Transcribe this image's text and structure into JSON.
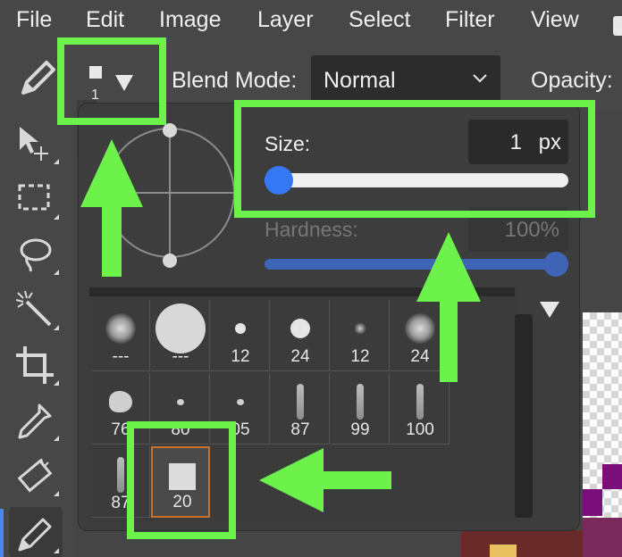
{
  "menu": {
    "items": [
      "File",
      "Edit",
      "Image",
      "Layer",
      "Select",
      "Filter",
      "View"
    ]
  },
  "options_bar": {
    "brush_preview_size": "1",
    "blend_mode_label": "Blend Mode:",
    "blend_mode_value": "Normal",
    "opacity_label": "Opacity:"
  },
  "toolbar": {
    "tools": [
      "pencil-icon",
      "move-icon",
      "marquee-icon",
      "lasso-icon",
      "magic-wand-icon",
      "crop-icon",
      "eyedropper-icon",
      "eraser-icon",
      "pencil-icon"
    ],
    "active_tool": "pencil-icon"
  },
  "brush_popup": {
    "size_label": "Size:",
    "size_value": "1",
    "size_unit": "px",
    "size_fraction": 0,
    "hardness_label": "Hardness:",
    "hardness_value": "100%",
    "hardness_fraction": 1,
    "presets": [
      {
        "label": "---",
        "kind": "soft"
      },
      {
        "label": "---",
        "kind": "hard-large"
      },
      {
        "label": "12",
        "kind": "hard"
      },
      {
        "label": "24",
        "kind": "hard"
      },
      {
        "label": "12",
        "kind": "soft-small"
      },
      {
        "label": "24",
        "kind": "soft"
      },
      {
        "label": "76",
        "kind": "splat"
      },
      {
        "label": "80",
        "kind": "dot"
      },
      {
        "label": "05",
        "kind": "dot"
      },
      {
        "label": "87",
        "kind": "stroke"
      },
      {
        "label": "99",
        "kind": "stroke"
      },
      {
        "label": "100",
        "kind": "stroke"
      },
      {
        "label": "87",
        "kind": "stroke"
      },
      {
        "label": "20",
        "kind": "square",
        "selected": true
      }
    ]
  },
  "colors": {
    "annotation": "#6cf24b",
    "accent": "#3478f6",
    "selected_preset_border": "#c9712b"
  }
}
